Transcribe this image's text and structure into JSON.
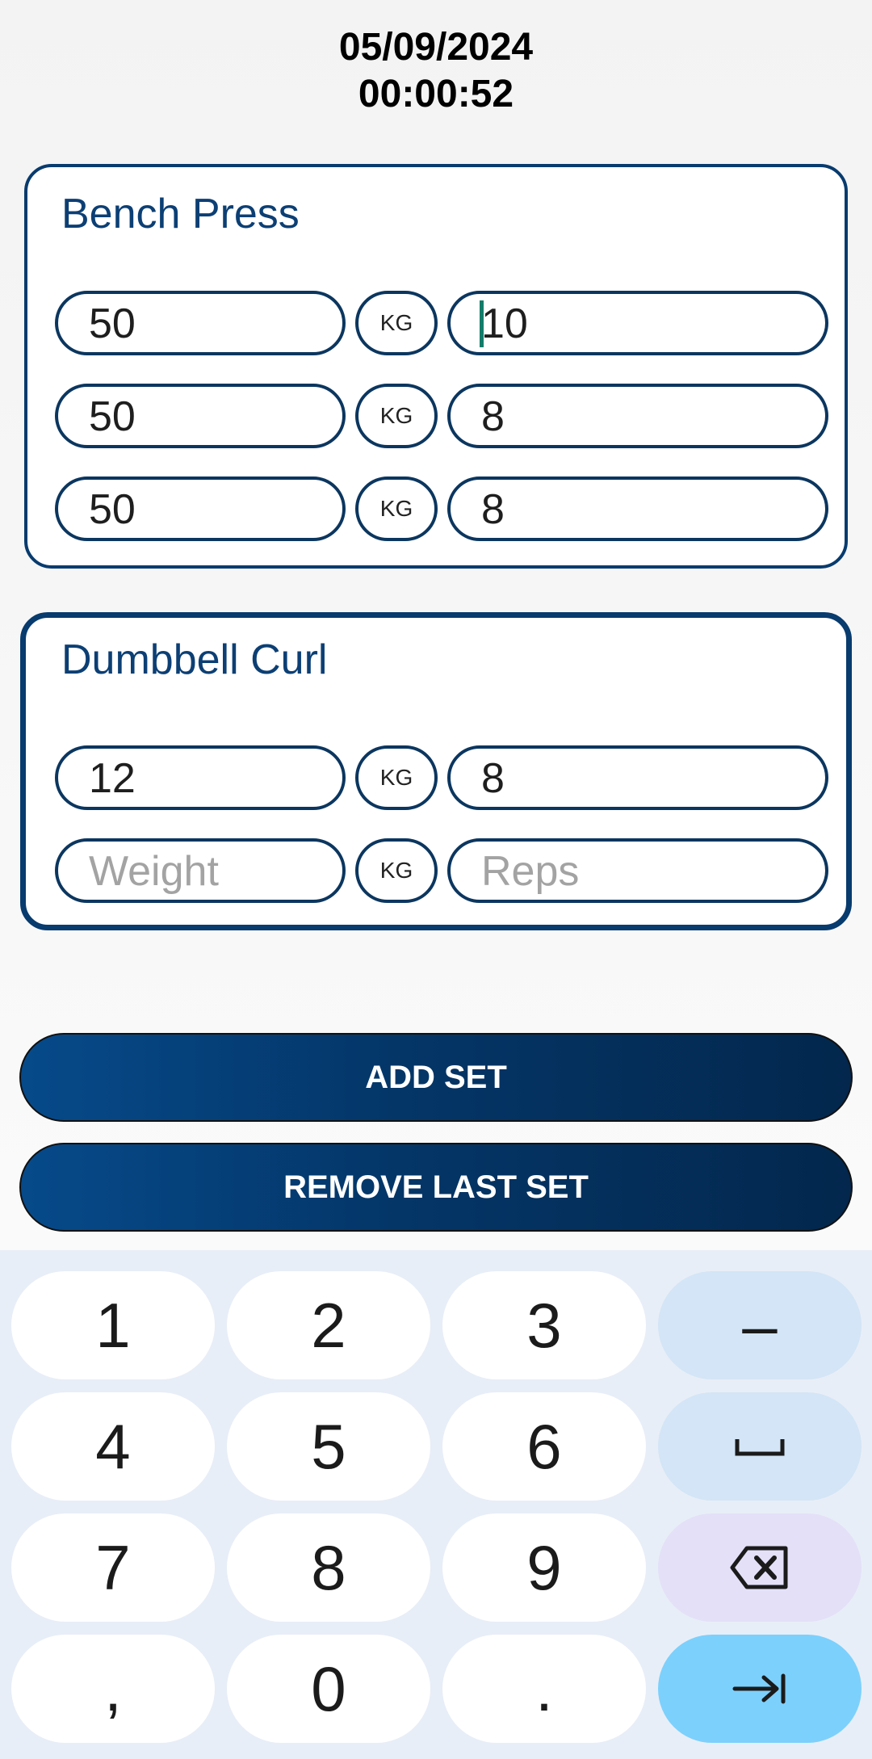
{
  "header": {
    "date": "05/09/2024",
    "timer": "00:00:52"
  },
  "exercises": [
    {
      "name": "Bench Press",
      "sets": [
        {
          "weight": "50",
          "unit": "KG",
          "reps": "10"
        },
        {
          "weight": "50",
          "unit": "KG",
          "reps": "8"
        },
        {
          "weight": "50",
          "unit": "KG",
          "reps": "8"
        }
      ]
    },
    {
      "name": "Dumbbell Curl",
      "sets": [
        {
          "weight": "12",
          "unit": "KG",
          "reps": "8"
        },
        {
          "weight": "",
          "unit": "KG",
          "reps": "",
          "weight_placeholder": "Weight",
          "reps_placeholder": "Reps"
        }
      ]
    }
  ],
  "buttons": {
    "add_set": "ADD SET",
    "remove_last_set": "REMOVE LAST SET"
  },
  "keyboard": {
    "keys": [
      "1",
      "2",
      "3",
      "–",
      "4",
      "5",
      "6",
      "␣",
      "7",
      "8",
      "9",
      "⌫",
      ",",
      "0",
      ".",
      "⇥"
    ],
    "icons": {
      "space": "space-bar-icon",
      "backspace": "backspace-icon",
      "next": "tab-next-icon"
    },
    "colors": {
      "background": "#e8eef7",
      "key": "#ffffff",
      "function_key": "#d3e5f6",
      "backspace_key": "#e3e0f8",
      "action_key": "#7cd0fc"
    }
  },
  "colors": {
    "accent": "#083b6e",
    "button_start": "#064a8a",
    "button_end": "#03274d",
    "cursor": "#137c6a"
  }
}
